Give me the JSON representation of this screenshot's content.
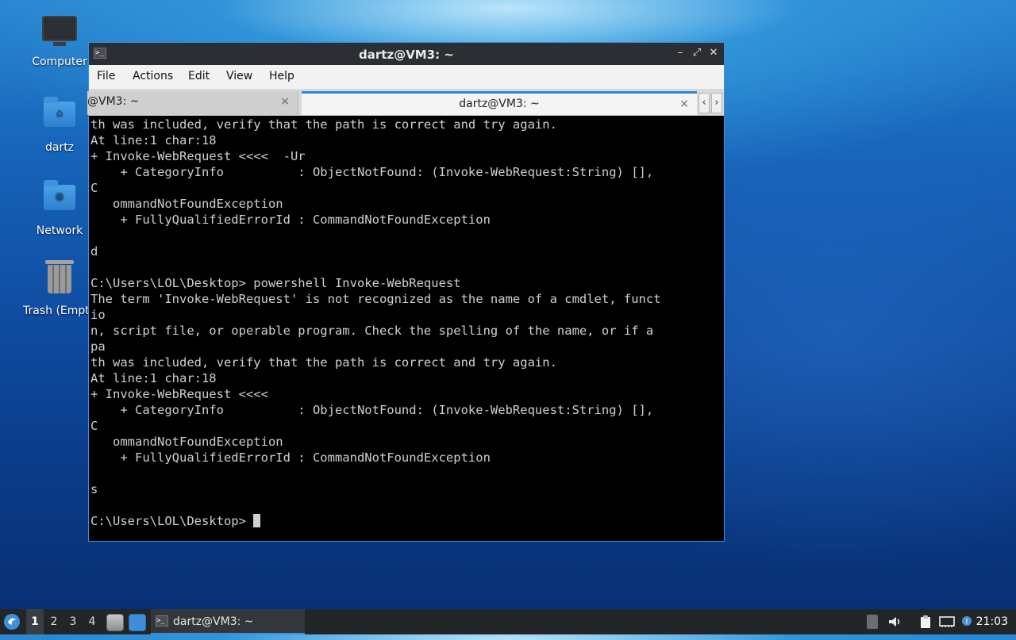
{
  "desktop": {
    "icons": [
      {
        "label": "Computer"
      },
      {
        "label": "dartz"
      },
      {
        "label": "Network"
      },
      {
        "label": "Trash (Empty)"
      }
    ]
  },
  "window": {
    "title": "dartz@VM3: ~",
    "menu": [
      "File",
      "Actions",
      "Edit",
      "View",
      "Help"
    ],
    "tabs": [
      {
        "label": "@VM3: ~",
        "close": "×"
      },
      {
        "label": "dartz@VM3: ~",
        "close": "×"
      }
    ],
    "controls": {
      "minimize": "–",
      "maximize": "⤢",
      "close": "✕"
    },
    "console_lines": [
      "th was included, verify that the path is correct and try again.",
      "At line:1 char:18",
      "+ Invoke-WebRequest <<<<  -Ur",
      "    + CategoryInfo          : ObjectNotFound: (Invoke-WebRequest:String) [],",
      "C",
      "   ommandNotFoundException",
      "    + FullyQualifiedErrorId : CommandNotFoundException",
      "",
      "d",
      "",
      "C:\\Users\\LOL\\Desktop> powershell Invoke-WebRequest",
      "The term 'Invoke-WebRequest' is not recognized as the name of a cmdlet, funct",
      "io",
      "n, script file, or operable program. Check the spelling of the name, or if a",
      "pa",
      "th was included, verify that the path is correct and try again.",
      "At line:1 char:18",
      "+ Invoke-WebRequest <<<<",
      "    + CategoryInfo          : ObjectNotFound: (Invoke-WebRequest:String) [],",
      "C",
      "   ommandNotFoundException",
      "    + FullyQualifiedErrorId : CommandNotFoundException",
      "",
      "s",
      ""
    ],
    "prompt": "C:\\Users\\LOL\\Desktop> "
  },
  "taskbar": {
    "workspaces": [
      "1",
      "2",
      "3",
      "4"
    ],
    "task_label": "dartz@VM3: ~",
    "clock": "21:03"
  },
  "colors": {
    "accent": "#3d8de0",
    "titlebar": "#2b2e33",
    "taskbar": "#232629"
  }
}
